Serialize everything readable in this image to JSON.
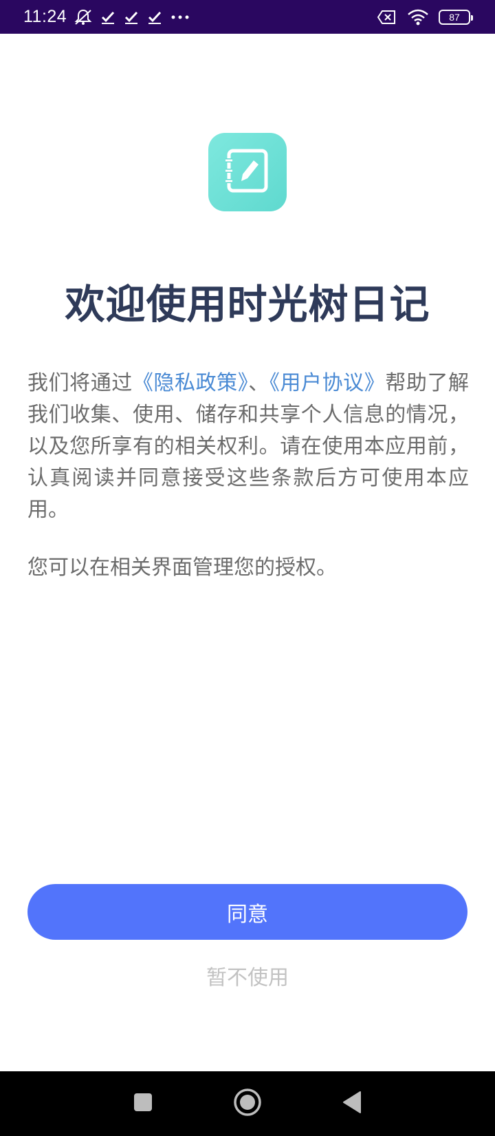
{
  "status_bar": {
    "time": "11:24",
    "battery_level": "87",
    "left_icons": [
      "mute-notification-icon",
      "check-icon",
      "check-icon",
      "check-icon",
      "more-dots-icon"
    ],
    "right_icons": [
      "sim-off-icon",
      "wifi-icon",
      "battery-icon"
    ]
  },
  "app": {
    "icon": "notebook-edit-icon",
    "accent_color": "#6fe2d7"
  },
  "dialog": {
    "title": "欢迎使用时光树日记",
    "para1_before": "我们将通过",
    "privacy_link": "《隐私政策》",
    "separator": "、",
    "agreement_link": "《用户协议》",
    "para1_after": "帮助了解我们收集、使用、储存和共享个人信息的情况，以及您所享有的相关权利。请在使用本应用前，认真阅读并同意接受这些条款后方可使用本应用。",
    "para2": "您可以在相关界面管理您的授权。",
    "agree_label": "同意",
    "decline_label": "暂不使用",
    "primary_color": "#5274fb",
    "link_color": "#4a8ad4"
  },
  "nav_bar": {
    "buttons": [
      "recents-square-icon",
      "home-circle-icon",
      "back-triangle-icon"
    ]
  }
}
